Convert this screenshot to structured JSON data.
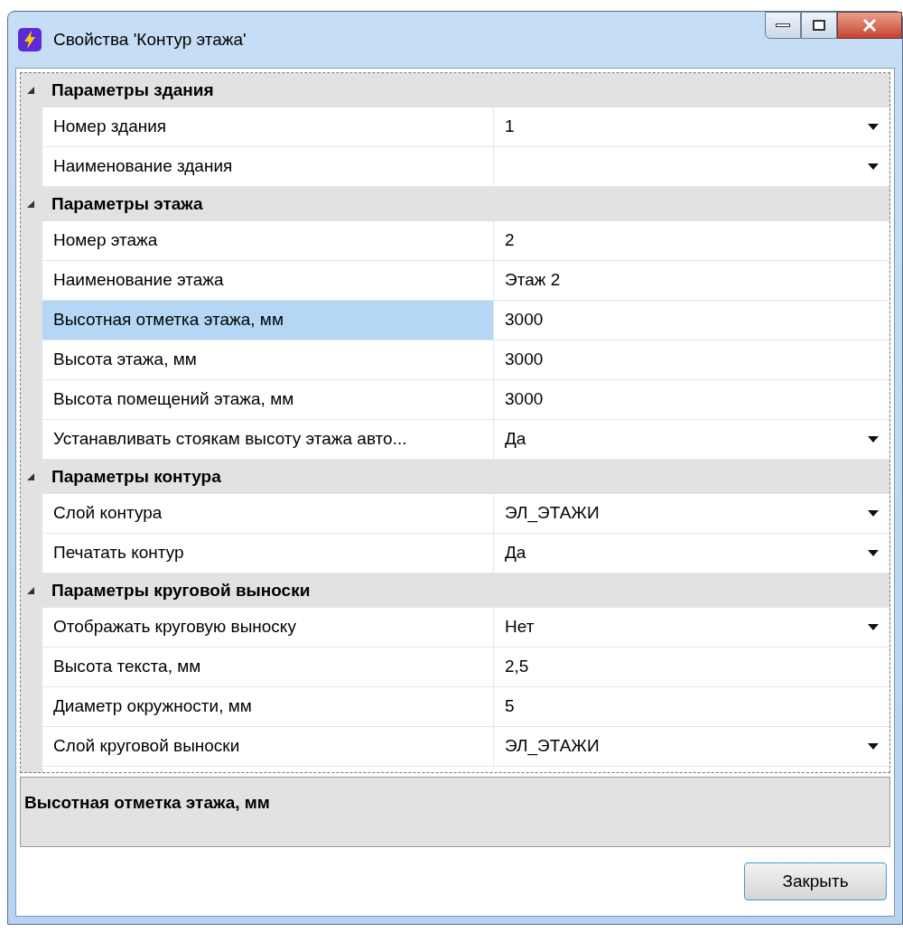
{
  "window": {
    "title": "Свойства 'Контур этажа'"
  },
  "categories": [
    {
      "title": "Параметры здания",
      "expanded": true,
      "rows": [
        {
          "label": "Номер здания",
          "value": "1",
          "dropdown": true,
          "selected": false
        },
        {
          "label": "Наименование здания",
          "value": "",
          "dropdown": true,
          "selected": false
        }
      ]
    },
    {
      "title": "Параметры этажа",
      "expanded": true,
      "rows": [
        {
          "label": "Номер этажа",
          "value": "2",
          "dropdown": false,
          "selected": false
        },
        {
          "label": "Наименование этажа",
          "value": "Этаж 2",
          "dropdown": false,
          "selected": false
        },
        {
          "label": "Высотная отметка этажа, мм",
          "value": "3000",
          "dropdown": false,
          "selected": true
        },
        {
          "label": "Высота этажа, мм",
          "value": "3000",
          "dropdown": false,
          "selected": false
        },
        {
          "label": "Высота помещений этажа, мм",
          "value": "3000",
          "dropdown": false,
          "selected": false
        },
        {
          "label": "Устанавливать стоякам высоту этажа авто...",
          "value": "Да",
          "dropdown": true,
          "selected": false
        }
      ]
    },
    {
      "title": "Параметры контура",
      "expanded": true,
      "rows": [
        {
          "label": "Слой контура",
          "value": "ЭЛ_ЭТАЖИ",
          "dropdown": true,
          "selected": false
        },
        {
          "label": "Печатать контур",
          "value": "Да",
          "dropdown": true,
          "selected": false
        }
      ]
    },
    {
      "title": "Параметры круговой выноски",
      "expanded": true,
      "rows": [
        {
          "label": "Отображать круговую выноску",
          "value": "Нет",
          "dropdown": true,
          "selected": false
        },
        {
          "label": "Высота текста, мм",
          "value": "2,5",
          "dropdown": false,
          "selected": false
        },
        {
          "label": "Диаметр окружности, мм",
          "value": "5",
          "dropdown": false,
          "selected": false
        },
        {
          "label": "Слой круговой выноски",
          "value": "ЭЛ_ЭТАЖИ",
          "dropdown": true,
          "selected": false
        }
      ]
    }
  ],
  "description": {
    "title": "Высотная отметка этажа, мм"
  },
  "buttons": [
    "Закрыть"
  ]
}
